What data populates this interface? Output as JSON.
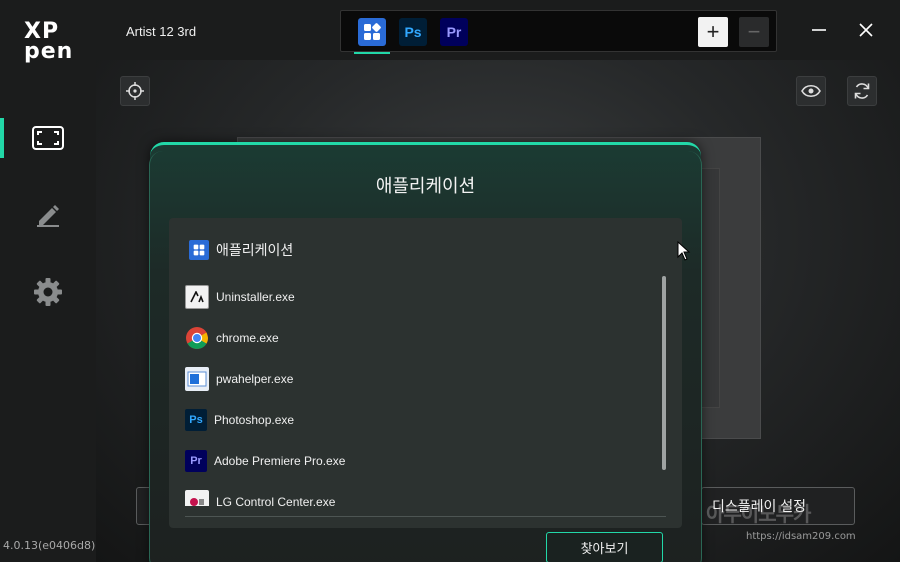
{
  "app": {
    "version": "4.0.13(e0406d8)",
    "device_name": "Artist 12 3rd"
  },
  "logo": {
    "line1": "XP",
    "line2": "pen"
  },
  "sidebar": {
    "items": [
      {
        "name": "display-mapping",
        "icon": "screen-frame-icon",
        "active": true
      },
      {
        "name": "pen",
        "icon": "pen-icon",
        "active": false
      },
      {
        "name": "settings",
        "icon": "gear-icon",
        "active": false
      }
    ]
  },
  "app_tabs": [
    {
      "icon": "all-apps-icon",
      "label": "",
      "active": true,
      "color": "#2a6bd6"
    },
    {
      "icon": "photoshop-icon",
      "label": "Ps",
      "active": false,
      "color": "#31a8ff"
    },
    {
      "icon": "premiere-icon",
      "label": "Pr",
      "active": false,
      "color": "#9999ff"
    }
  ],
  "tab_controls": {
    "add": "+",
    "remove": "−"
  },
  "window_controls": {
    "minimize": "—",
    "close": "✕"
  },
  "main": {
    "left_button_label": "",
    "right_button_label": "디스플레이 설정"
  },
  "dialog": {
    "title": "애플리케이션",
    "panel_header": "애플리케이션",
    "items": [
      {
        "label": "Uninstaller.exe",
        "icon": "uninstaller-icon"
      },
      {
        "label": "chrome.exe",
        "icon": "chrome-icon"
      },
      {
        "label": "pwahelper.exe",
        "icon": "pwahelper-icon"
      },
      {
        "label": "Photoshop.exe",
        "icon": "photoshop-icon",
        "badge": "Ps"
      },
      {
        "label": "Adobe Premiere Pro.exe",
        "icon": "premiere-icon",
        "badge": "Pr"
      },
      {
        "label": "LG Control Center.exe",
        "icon": "lg-control-icon"
      }
    ],
    "browse_label": "찾아보기"
  },
  "watermark": {
    "big": "아두이노두카",
    "url": "https://idsam209.com"
  },
  "colors": {
    "accent": "#22d8a8",
    "photoshop": "#31a8ff",
    "premiere": "#9999ff",
    "apps_blue": "#2a6bd6"
  }
}
